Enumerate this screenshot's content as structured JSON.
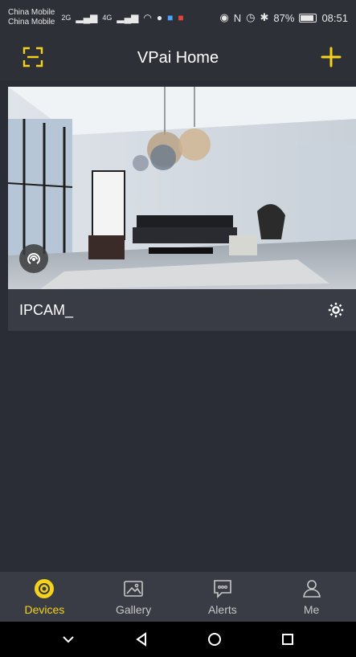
{
  "status_bar": {
    "carrier_1": "China Mobile",
    "carrier_2": "China Mobile",
    "network_1": "2G",
    "network_2": "4G",
    "battery_percent": "87%",
    "time": "08:51"
  },
  "header": {
    "title": "VPai Home",
    "left_icon": "scan-icon",
    "right_icon": "plus-icon"
  },
  "device": {
    "name": "IPCAM_",
    "settings_icon": "gear-icon",
    "preview_badge_icon": "broadcast-icon"
  },
  "bottom_nav": {
    "items": [
      {
        "label": "Devices",
        "icon": "devices-icon",
        "active": true
      },
      {
        "label": "Gallery",
        "icon": "gallery-icon",
        "active": false
      },
      {
        "label": "Alerts",
        "icon": "alerts-icon",
        "active": false
      },
      {
        "label": "Me",
        "icon": "user-icon",
        "active": false
      }
    ]
  },
  "colors": {
    "accent": "#f6d21b",
    "background": "#2b2d36",
    "panel": "#3a3c45",
    "header": "#2e3038"
  }
}
